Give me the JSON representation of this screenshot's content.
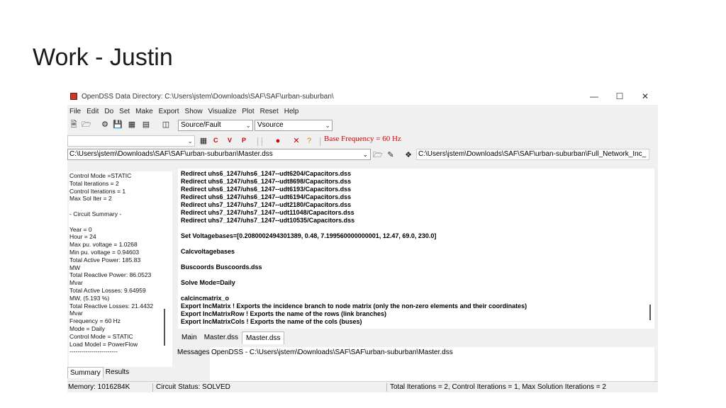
{
  "slide": {
    "title": "Work - Justin"
  },
  "window": {
    "title": "OpenDSS Data Directory: C:\\Users\\jstem\\Downloads\\SAF\\SAF\\urban-suburban\\",
    "minimize": "—",
    "maximize": "☐",
    "close": "✕"
  },
  "menu": [
    "File",
    "Edit",
    "Do",
    "Set",
    "Make",
    "Export",
    "Show",
    "Visualize",
    "Plot",
    "Reset",
    "Help"
  ],
  "toolbar": {
    "mode_select": "Source/Fault",
    "element_select": "Vsource",
    "class_select": "",
    "c_label": "C",
    "v_label": "V",
    "p_label": "P",
    "base_frequency": "Base Frequency = 60 Hz"
  },
  "address": {
    "script_path": "C:\\Users\\jstem\\Downloads\\SAF\\SAF\\urban-suburban\\Master.dss",
    "dir_path": "C:\\Users\\jstem\\Downloads\\SAF\\SAF\\urban-suburban\\Full_Network_Inc_"
  },
  "summary_lines": [
    "Control Mode =STATIC",
    "Total Iterations = 2",
    "Control Iterations = 1",
    "Max Sol Iter = 2",
    "",
    " - Circuit Summary -",
    "",
    "Year = 0",
    "Hour = 24",
    "Max pu. voltage = 1.0268",
    "Min pu. voltage = 0.94603",
    "Total Active Power:   185.83",
    "MW",
    "Total Reactive Power: 86.0523",
    "Mvar",
    "Total Active Losses:   9.64959",
    "MW, (5.193 %)",
    "Total Reactive Losses: 21.4432",
    "Mvar",
    "Frequency = 60 Hz",
    "Mode = Daily",
    "Control Mode = STATIC",
    "Load Model = PowerFlow",
    "------------------------"
  ],
  "left_tabs": [
    "Summary",
    "Results"
  ],
  "editor_lines": [
    "Redirect uhs6_1247/uhs6_1247--udt6204/Capacitors.dss",
    "Redirect uhs6_1247/uhs6_1247--udt8698/Capacitors.dss",
    "Redirect uhs6_1247/uhs6_1247--udt6193/Capacitors.dss",
    "Redirect uhs6_1247/uhs6_1247--udt6194/Capacitors.dss",
    "Redirect uhs7_1247/uhs7_1247--udt2180/Capacitors.dss",
    "Redirect uhs7_1247/uhs7_1247--udt11048/Capacitors.dss",
    "Redirect uhs7_1247/uhs7_1247--udt10535/Capacitors.dss",
    "",
    "Set Voltagebases=[0.2080002494301389, 0.48, 7.199560000000001, 12.47, 69.0, 230.0]",
    "",
    "Calcvoltagebases",
    "",
    "Buscoords Buscoords.dss",
    "",
    "Solve Mode=Daily",
    "",
    "calcincmatrix_o",
    "Export IncMatrix     ! Exports the incidence branch to node matrix (only the non-zero elements and their coordinates)",
    "Export IncMatrixRow  ! Exports the name of the rows (link branches)",
    "Export IncMatrixCols ! Exports the name of the cols (buses)"
  ],
  "editor_tabs": [
    "Main",
    "Master.dss",
    "Master.dss"
  ],
  "messages": {
    "label": "Messages",
    "text": "OpenDSS - C:\\Users\\jstem\\Downloads\\SAF\\SAF\\urban-suburban\\Master.dss"
  },
  "status": {
    "memory": "Memory: 1016284K",
    "circuit": "Circuit Status: SOLVED",
    "iterations": "Total Iterations = 2, Control Iterations = 1,  Max Solution Iterations = 2"
  }
}
